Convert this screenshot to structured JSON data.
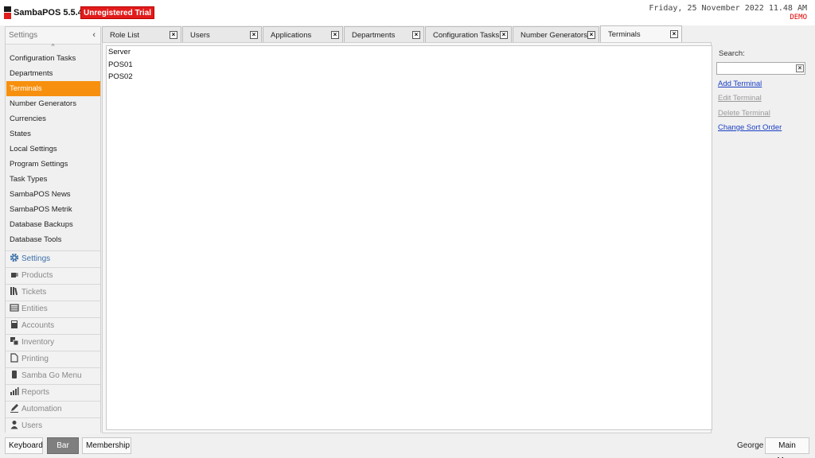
{
  "app": {
    "title": "SambaPOS 5.5.4",
    "trial_badge": "Unregistered Trial",
    "datetime": "Friday, 25 November 2022 11.48 AM",
    "mode": "DEMO",
    "brand_color": "#e21b1b"
  },
  "left_panel": {
    "title": "Settings",
    "collapse_icon": "chevron-left-icon",
    "items": [
      {
        "label": "Configuration Tasks"
      },
      {
        "label": "Departments"
      },
      {
        "label": "Terminals",
        "active": true
      },
      {
        "label": "Number Generators"
      },
      {
        "label": "Currencies"
      },
      {
        "label": "States"
      },
      {
        "label": "Local Settings"
      },
      {
        "label": "Program Settings"
      },
      {
        "label": "Task Types"
      },
      {
        "label": "SambaPOS News"
      },
      {
        "label": "SambaPOS Metrik"
      },
      {
        "label": "Database Backups"
      },
      {
        "label": "Database Tools"
      }
    ],
    "active_color": "#f7900e"
  },
  "modules": [
    {
      "label": "Settings",
      "icon": "gear-icon",
      "active": true
    },
    {
      "label": "Products",
      "icon": "coffee-cup-icon"
    },
    {
      "label": "Tickets",
      "icon": "books-icon"
    },
    {
      "label": "Entities",
      "icon": "table-grid-icon"
    },
    {
      "label": "Accounts",
      "icon": "calculator-icon"
    },
    {
      "label": "Inventory",
      "icon": "boxes-icon"
    },
    {
      "label": "Printing",
      "icon": "document-icon"
    },
    {
      "label": "Samba Go Menu",
      "icon": "mobile-phone-icon"
    },
    {
      "label": "Reports",
      "icon": "bar-chart-icon"
    },
    {
      "label": "Automation",
      "icon": "pencil-icon"
    },
    {
      "label": "Users",
      "icon": "user-icon"
    }
  ],
  "tabs": [
    {
      "label": "Role List"
    },
    {
      "label": "Users"
    },
    {
      "label": "Applications"
    },
    {
      "label": "Departments"
    },
    {
      "label": "Configuration Tasks"
    },
    {
      "label": "Number Generators"
    },
    {
      "label": "Terminals",
      "active": true
    }
  ],
  "terminals": [
    "Server",
    "POS01",
    "POS02"
  ],
  "right_panel": {
    "search_label": "Search:",
    "search_value": "",
    "actions": [
      {
        "label": "Add Terminal",
        "enabled": true
      },
      {
        "label": "Edit Terminal",
        "enabled": false
      },
      {
        "label": "Delete Terminal",
        "enabled": false
      },
      {
        "label": "Change Sort Order",
        "enabled": true
      }
    ]
  },
  "footer": {
    "keyboard": "Keyboard",
    "bar": "Bar",
    "membership": "Membership",
    "user": "George",
    "main_menu": "Main Menu"
  }
}
